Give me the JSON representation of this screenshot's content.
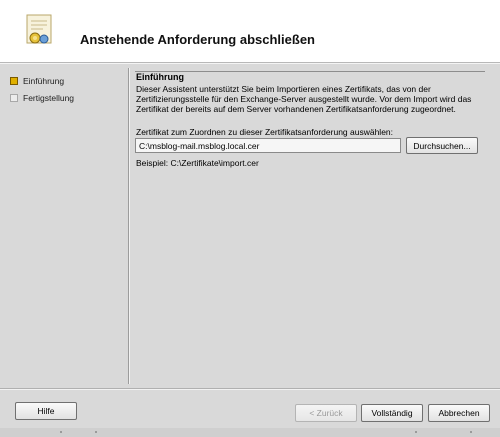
{
  "header": {
    "title": "Anstehende Anforderung abschließen",
    "icon": "certificate-wizard-icon"
  },
  "steps": [
    {
      "label": "Einführung",
      "active": true
    },
    {
      "label": "Fertigstellung",
      "active": false
    }
  ],
  "section": {
    "title": "Einführung",
    "description": "Dieser Assistent unterstützt Sie beim Importieren eines Zertifikats, das von der Zertifizierungsstelle für den Exchange-Server ausgestellt wurde. Vor dem Import wird das Zertifikat der bereits auf dem Server vorhandenen Zertifikatsanforderung zugeordnet.",
    "field_label": "Zertifikat zum Zuordnen zu dieser Zertifikatsanforderung auswählen:",
    "path_value": "C:\\msblog-mail.msblog.local.cer",
    "browse_label": "Durchsuchen...",
    "example": "Beispiel: C:\\Zertifikate\\import.cer"
  },
  "buttons": {
    "help": "Hilfe",
    "back": "< Zurück",
    "finish": "Vollständig",
    "cancel": "Abbrechen"
  },
  "colors": {
    "active_step": "#e0b000",
    "background": "#d9d9d9"
  }
}
